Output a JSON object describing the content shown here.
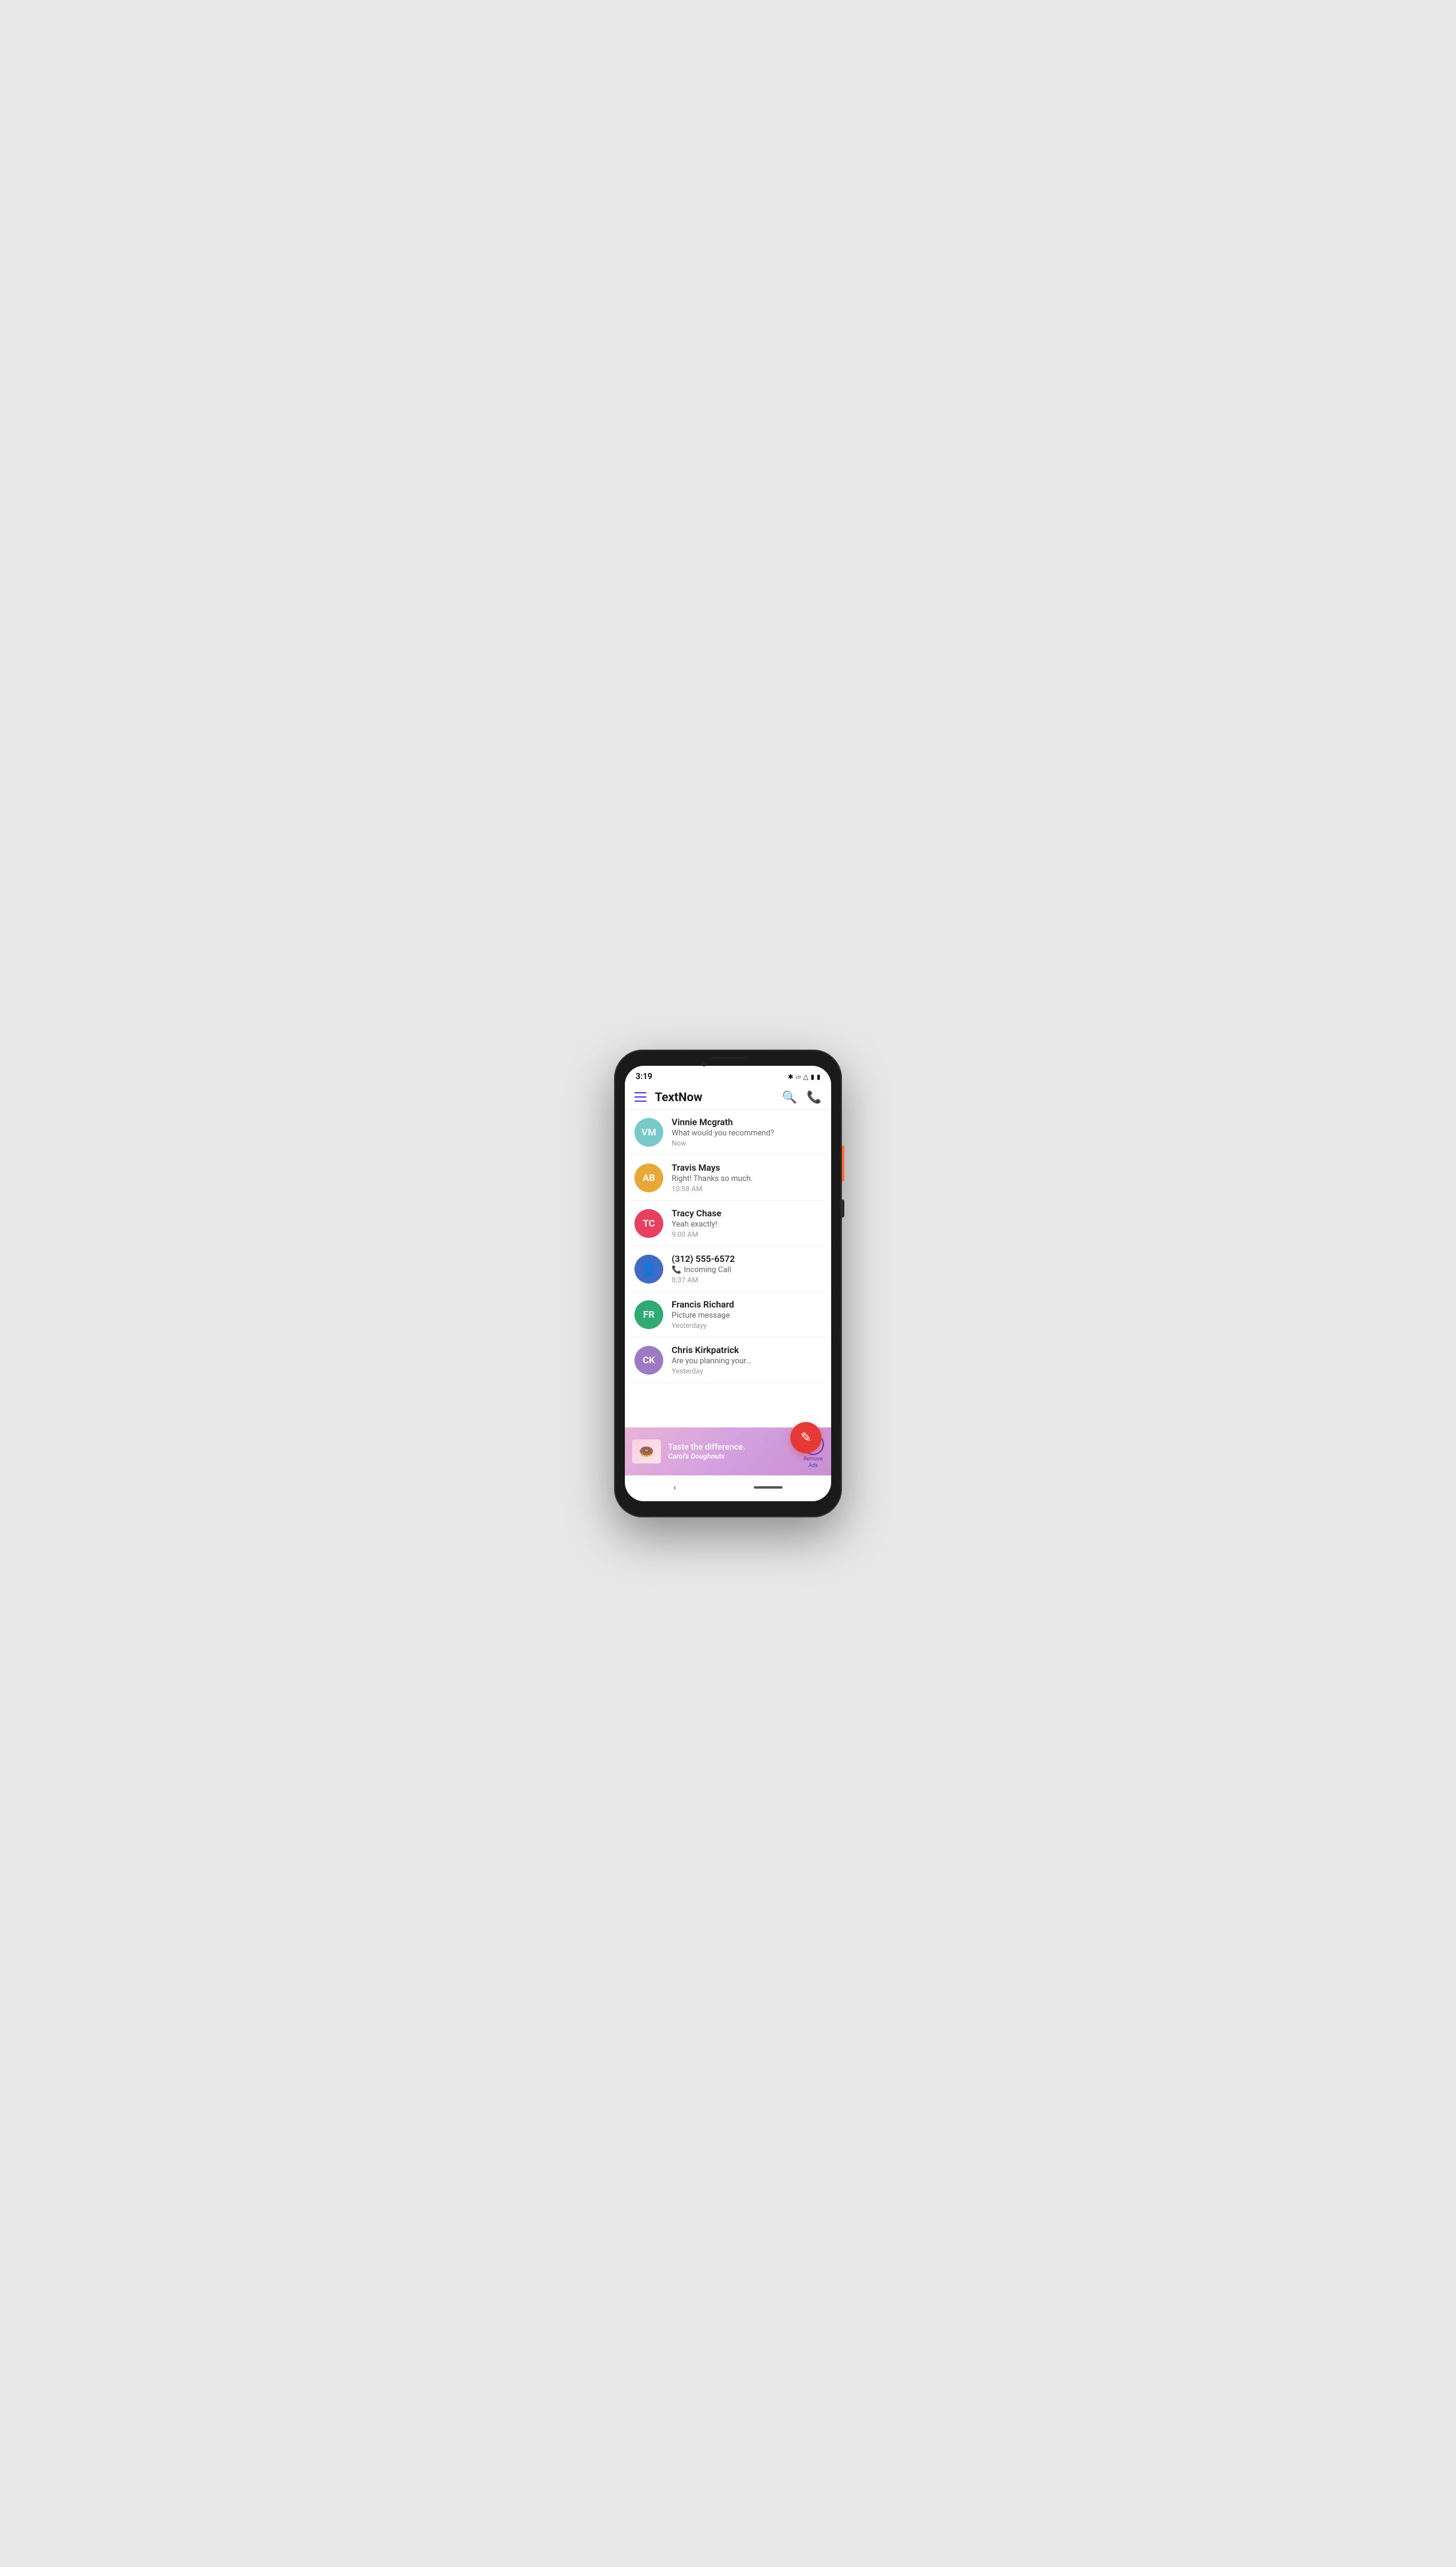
{
  "statusBar": {
    "time": "3:19",
    "icons": [
      "bluetooth",
      "vibrate",
      "wifi",
      "signal",
      "battery"
    ]
  },
  "appBar": {
    "title": "TextNow",
    "searchLabel": "search",
    "dialLabel": "dialpad"
  },
  "conversations": [
    {
      "id": "vm",
      "initials": "VM",
      "name": "Vinnie Mcgrath",
      "preview": "What would you recommend?",
      "time": "Now",
      "avatarColor": "#78C9C9",
      "hasCallIcon": false
    },
    {
      "id": "ab",
      "initials": "AB",
      "name": "Travis Mays",
      "preview": "Right! Thanks so much.",
      "time": "10:58 AM",
      "avatarColor": "#E8A838",
      "hasCallIcon": false
    },
    {
      "id": "tc",
      "initials": "TC",
      "name": "Tracy Chase",
      "preview": "Yeah exactly!",
      "time": "9:00 AM",
      "avatarColor": "#E84060",
      "hasCallIcon": false
    },
    {
      "id": "unknown",
      "initials": "?",
      "name": "(312) 555-6572",
      "preview": "Incoming Call",
      "time": "8:37 AM",
      "avatarColor": "#3F6BC4",
      "hasCallIcon": true,
      "isPersonIcon": true
    },
    {
      "id": "fr",
      "initials": "FR",
      "name": "Francis Richard",
      "preview": "Picture message",
      "time": "Yesterdayy",
      "avatarColor": "#2EAA72",
      "hasCallIcon": false
    },
    {
      "id": "ck",
      "initials": "CK",
      "name": "Chris Kirkpatrick",
      "preview": "Are you planning your…",
      "time": "Yesterday",
      "avatarColor": "#9C7AC4",
      "hasCallIcon": false
    }
  ],
  "fab": {
    "label": "compose",
    "icon": "✎"
  },
  "ad": {
    "text": "Taste the difference.",
    "brand": "Carol's\nDoughnuts",
    "removeLabel": "Remove\nAds"
  },
  "bottomNav": {
    "backIcon": "‹",
    "pillLabel": "home-indicator"
  }
}
